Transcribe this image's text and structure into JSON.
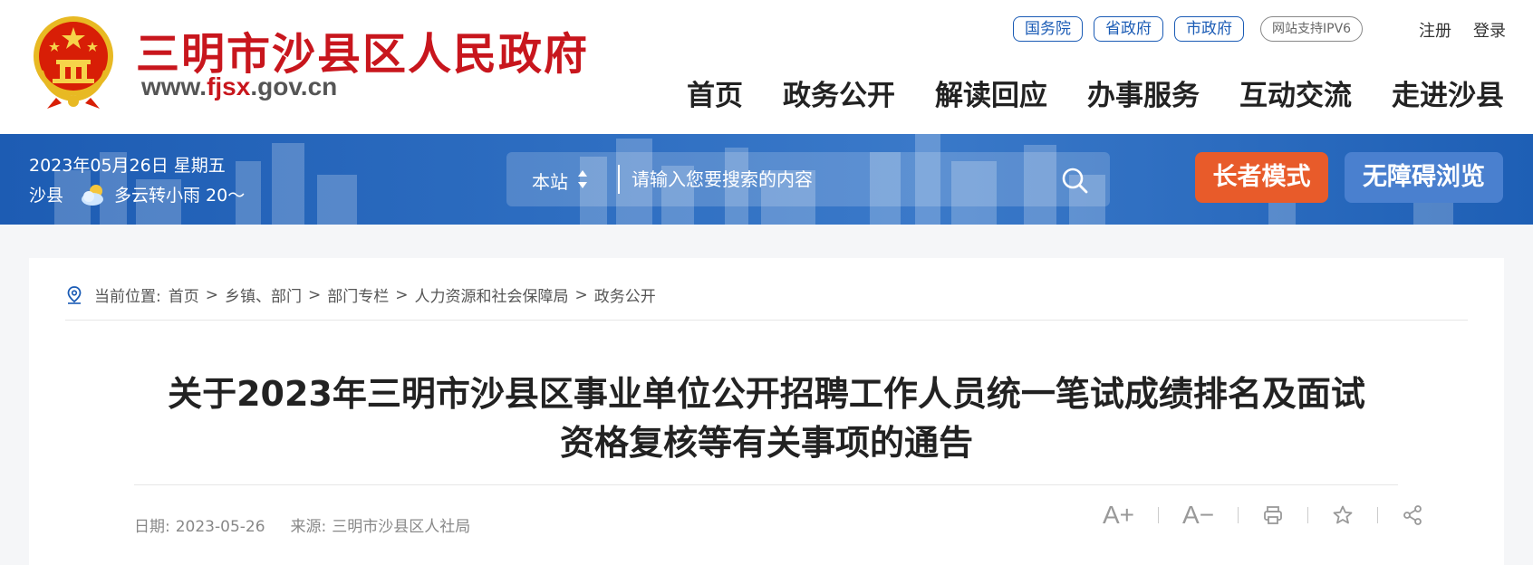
{
  "header": {
    "site_title": "三明市沙县区人民政府",
    "site_url_prefix": "www.",
    "site_url_domain": "fjsx",
    "site_url_suffix": ".gov.cn",
    "top_links": [
      "国务院",
      "省政府",
      "市政府"
    ],
    "ipv6_badge": "网站支持IPV6",
    "register_label": "注册",
    "login_label": "登录",
    "nav": [
      "首页",
      "政务公开",
      "解读回应",
      "办事服务",
      "互动交流",
      "走进沙县"
    ]
  },
  "banner": {
    "date": "2023年05月26日 星期五",
    "location": "沙县",
    "weather": "多云转小雨 20～",
    "search_scope": "本站",
    "search_placeholder": "请输入您要搜索的内容",
    "elder_mode_label": "长者模式",
    "accessible_label": "无障碍浏览"
  },
  "breadcrumb": {
    "prefix": "当前位置:",
    "items": [
      "首页",
      "乡镇、部门",
      "部门专栏",
      "人力资源和社会保障局",
      "政务公开"
    ]
  },
  "article": {
    "title_line1": "关于2023年三明市沙县区事业单位公开招聘工作人员统一笔试成绩排名及面试",
    "title_line2": "资格复核等有关事项的通告",
    "date_label": "日期:",
    "date": "2023-05-26",
    "source_label": "来源:",
    "source": "三明市沙县区人社局"
  },
  "tools": {
    "font_increase": "A+",
    "font_decrease": "A−"
  },
  "colors": {
    "brand_red": "#c8161d",
    "link_blue": "#1a5bb5",
    "banner_blue": "#1d5cb3",
    "elder_orange": "#e85b2a",
    "access_blue": "#4a80cf"
  }
}
